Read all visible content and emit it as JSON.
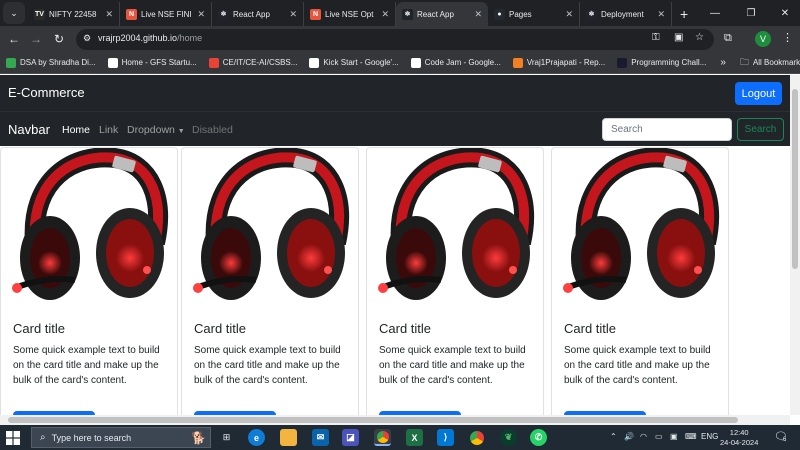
{
  "browser": {
    "tabs": [
      {
        "label": "NIFTY 22458",
        "icon": "chart-favicon",
        "color": "#2b2b2b",
        "glyph": "TV"
      },
      {
        "label": "Live NSE FINI",
        "icon": "nse-favicon",
        "color": "#e8553e",
        "glyph": "N"
      },
      {
        "label": "React App",
        "icon": "react-favicon",
        "color": "#20232a",
        "glyph": "⚛"
      },
      {
        "label": "Live NSE Opt",
        "icon": "nse-favicon",
        "color": "#e8553e",
        "glyph": "N"
      },
      {
        "label": "React App",
        "icon": "react-favicon",
        "color": "#20232a",
        "glyph": "⚛",
        "active": true
      },
      {
        "label": "Pages",
        "icon": "github-favicon",
        "color": "#24292f",
        "glyph": "●"
      },
      {
        "label": "Deployment",
        "icon": "react-favicon",
        "color": "#20232a",
        "glyph": "⚛"
      }
    ],
    "address": {
      "domain": "vrajrp2004.github.io",
      "path": "/home"
    },
    "profile_initial": "V",
    "bookmarks": [
      {
        "label": "DSA by Shradha Di...",
        "color": "#34a853"
      },
      {
        "label": "Home - GFS Startu...",
        "color": "#ffffff"
      },
      {
        "label": "CE/IT/CE-AI/CSBS...",
        "color": "#ea4335"
      },
      {
        "label": "Kick Start - Google'...",
        "color": "#ffffff"
      },
      {
        "label": "Code Jam - Google...",
        "color": "#ffffff"
      },
      {
        "label": "Vraj1Prajapati - Rep...",
        "color": "#f48024"
      },
      {
        "label": "Programming Chall...",
        "color": "#1a1a2e"
      }
    ],
    "all_bookmarks": "All Bookmarks"
  },
  "app": {
    "brand": "E-Commerce",
    "logout": "Logout",
    "navbar": {
      "brand": "Navbar",
      "links": [
        "Home",
        "Link",
        "Dropdown",
        "Disabled"
      ],
      "search_placeholder": "Search",
      "search_button": "Search"
    },
    "cards": [
      {
        "title": "Card title",
        "text": "Some quick example text to build on the card title and make up the bulk of the card's content."
      },
      {
        "title": "Card title",
        "text": "Some quick example text to build on the card title and make up the bulk of the card's content."
      },
      {
        "title": "Card title",
        "text": "Some quick example text to build on the card title and make up the bulk of the card's content."
      },
      {
        "title": "Card title",
        "text": "Some quick example text to build on the card title and make up the bulk of the card's content."
      }
    ],
    "accent": "#0d6efd",
    "success": "#198754",
    "dark": "#212529"
  },
  "taskbar": {
    "search_placeholder": "Type here to search",
    "language": "ENG",
    "time": "12:40",
    "date": "24-04-2024",
    "notification_count": "6"
  }
}
